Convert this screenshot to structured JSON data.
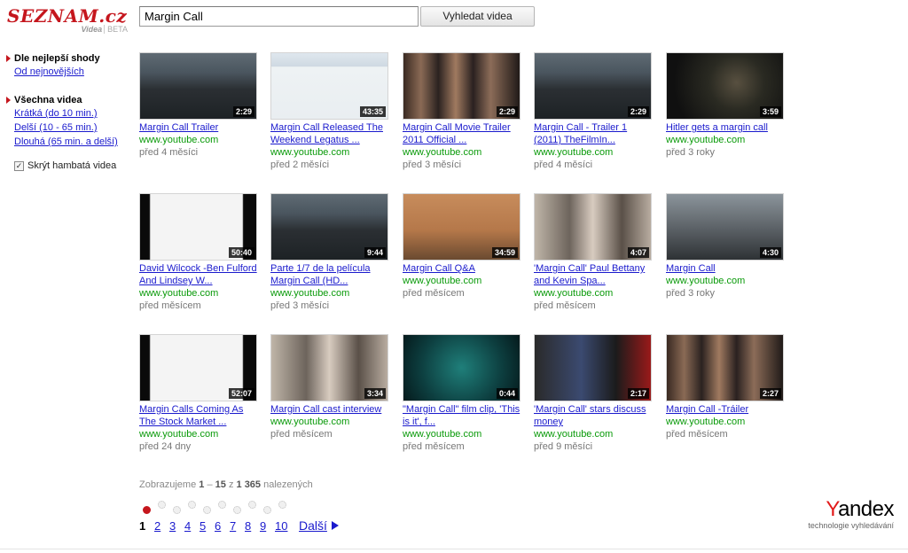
{
  "header": {
    "logo": "SEZNAM.cz",
    "logo_sub": "Videa",
    "logo_beta": "BETA",
    "search_value": "Margin Call",
    "search_button": "Vyhledat videa"
  },
  "sidebar": {
    "sort_heading": "Dle nejlepší shody",
    "sort_newest": "Od nejnovějších",
    "length_heading": "Všechna videa",
    "length_short": "Krátká (do 10 min.)",
    "length_medium": "Delší (10 - 65 min.)",
    "length_long": "Dlouhá (65 min. a delší)",
    "hide_adult": "Skrýt hambatá videa",
    "hide_adult_checked": true
  },
  "videos": [
    {
      "title": "Margin Call Trailer",
      "source": "www.youtube.com",
      "age": "před 4 měsíci",
      "duration": "2:29",
      "scene": "trading"
    },
    {
      "title": "Margin Call Released The Weekend Legatus ...",
      "source": "www.youtube.com",
      "age": "před 2 měsíci",
      "duration": "43:35",
      "scene": "chart"
    },
    {
      "title": "Margin Call Movie Trailer 2011 Official ...",
      "source": "www.youtube.com",
      "age": "před 3 měsíci",
      "duration": "2:29",
      "scene": "faces"
    },
    {
      "title": "Margin Call - Trailer 1 (2011) TheFilmIn...",
      "source": "www.youtube.com",
      "age": "před 4 měsíci",
      "duration": "2:29",
      "scene": "trading"
    },
    {
      "title": "Hitler gets a margin call",
      "source": "www.youtube.com",
      "age": "před 3 roky",
      "duration": "3:59",
      "scene": "dark"
    },
    {
      "title": "David Wilcock -Ben Fulford And Lindsey W...",
      "source": "www.youtube.com",
      "age": "před měsícem",
      "duration": "50:40",
      "scene": "web"
    },
    {
      "title": "Parte 1/7 de la película Margin Call (HD...",
      "source": "www.youtube.com",
      "age": "před 3 měsíci",
      "duration": "9:44",
      "scene": "trading"
    },
    {
      "title": "Margin Call Q&A",
      "source": "www.youtube.com",
      "age": "před měsícem",
      "duration": "34:59",
      "scene": "stage"
    },
    {
      "title": "'Margin Call' Paul Bettany and Kevin Spa...",
      "source": "www.youtube.com",
      "age": "před měsícem",
      "duration": "4:07",
      "scene": "interview"
    },
    {
      "title": "Margin Call",
      "source": "www.youtube.com",
      "age": "před 3 roky",
      "duration": "4:30",
      "scene": "street"
    },
    {
      "title": "Margin Calls Coming As The Stock Market ...",
      "source": "www.youtube.com",
      "age": "před 24 dny",
      "duration": "52:07",
      "scene": "web"
    },
    {
      "title": "Margin Call cast interview",
      "source": "www.youtube.com",
      "age": "před měsícem",
      "duration": "3:34",
      "scene": "interview"
    },
    {
      "title": "\"Margin Call\" film clip, 'This is it', f...",
      "source": "www.youtube.com",
      "age": "před měsícem",
      "duration": "0:44",
      "scene": "teal"
    },
    {
      "title": "'Margin Call' stars discuss money",
      "source": "www.youtube.com",
      "age": "před 9 měsíci",
      "duration": "2:17",
      "scene": "poster"
    },
    {
      "title": "Margin Call -Tráiler",
      "source": "www.youtube.com",
      "age": "před měsícem",
      "duration": "2:27",
      "scene": "faces"
    }
  ],
  "results": {
    "prefix": "Zobrazujeme",
    "from": "1",
    "dash": "–",
    "to": "15",
    "of": "z",
    "total": "1 365",
    "suffix": "nalezených"
  },
  "pagination": {
    "pages": [
      "1",
      "2",
      "3",
      "4",
      "5",
      "6",
      "7",
      "8",
      "9",
      "10"
    ],
    "current": "1",
    "next_label": "Další"
  },
  "footer": {
    "yandex_first": "Y",
    "yandex_rest": "andex",
    "yandex_tagline": "technologie vyhledávání"
  },
  "colors": {
    "brand_red": "#c5161d",
    "link_blue": "#1a1acd",
    "url_green": "#0a9a0a"
  }
}
